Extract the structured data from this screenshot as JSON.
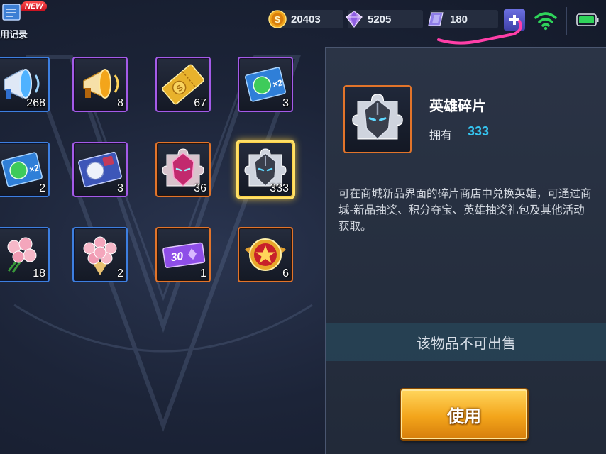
{
  "topbar": {
    "record": {
      "badge": "NEW",
      "label": "用记录"
    },
    "currencies": [
      {
        "name": "gold",
        "icon": "gold-coin-icon",
        "value": "20403"
      },
      {
        "name": "diamond",
        "icon": "diamond-icon",
        "value": "5205"
      },
      {
        "name": "voucher",
        "icon": "voucher-crystal-icon",
        "value": "180"
      }
    ],
    "status": {
      "wifi": "wifi-icon",
      "battery": "battery-icon"
    }
  },
  "inventory": {
    "items": [
      {
        "id": "megaphone-blue",
        "count": "268",
        "rarity": "blue"
      },
      {
        "id": "megaphone-gold",
        "count": "8",
        "rarity": "purple"
      },
      {
        "id": "gold-ticket",
        "count": "67",
        "rarity": "purple"
      },
      {
        "id": "exp-card-x2-a",
        "count": "3",
        "rarity": "purple"
      },
      {
        "id": "exp-card-x2-b",
        "count": "2",
        "rarity": "blue"
      },
      {
        "id": "rename-card",
        "count": "3",
        "rarity": "purple"
      },
      {
        "id": "skin-shard",
        "count": "36",
        "rarity": "orange"
      },
      {
        "id": "hero-shard",
        "count": "333",
        "rarity": "orange",
        "selected": true
      },
      {
        "id": "rose-small",
        "count": "18",
        "rarity": "blue"
      },
      {
        "id": "rose-bouquet",
        "count": "2",
        "rarity": "blue"
      },
      {
        "id": "purple-ticket-30",
        "count": "1",
        "rarity": "orange",
        "text": "30"
      },
      {
        "id": "star-medal",
        "count": "6",
        "rarity": "orange"
      }
    ]
  },
  "detail": {
    "name": "英雄碎片",
    "own_label": "拥有",
    "own_value": "333",
    "description": "可在商城新品界面的碎片商店中兑换英雄，可通过商城-新品抽奖、积分夺宝、英雄抽奖礼包及其他活动获取。",
    "no_sell": "该物品不可出售",
    "use_button": "使用"
  },
  "colors": {
    "rarity_blue": "#3d7fe0",
    "rarity_purple": "#a45be8",
    "rarity_orange": "#e2742a",
    "own_value": "#35c6f2",
    "use_button": "#f3a51b"
  }
}
